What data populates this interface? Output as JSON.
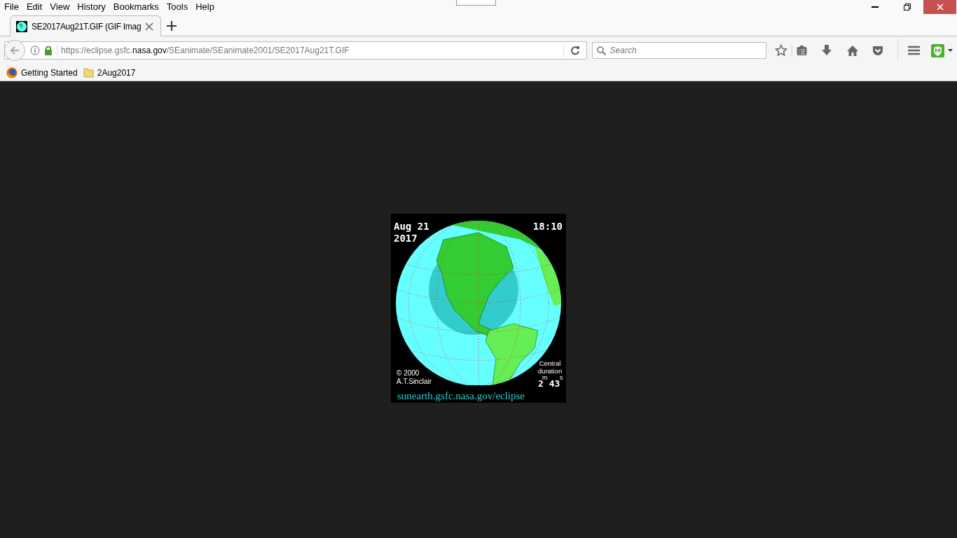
{
  "menu": [
    "File",
    "Edit",
    "View",
    "History",
    "Bookmarks",
    "Tools",
    "Help"
  ],
  "tab": {
    "title": "SE2017Aug21T.GIF (GIF Imag",
    "selected": true
  },
  "address": {
    "prefix": "https://eclipse.gsfc.",
    "domain": "nasa.gov",
    "path": "/SEanimate/SEanimate2001/SE2017Aug21T.GIF"
  },
  "search": {
    "placeholder": "Search"
  },
  "bookmarks": [
    {
      "kind": "firefox",
      "label": "Getting Started"
    },
    {
      "kind": "folder",
      "label": "2Aug2017"
    }
  ],
  "image": {
    "date": "Aug 21",
    "year": "2017",
    "time": "18:10",
    "copyright": "© 2000",
    "author": "A.T.Sinclair",
    "duration_label": "Central duration",
    "unit_minutes": "m",
    "unit_seconds": "s",
    "duration": "2 43",
    "site": "sunearth.gsfc.nasa.gov/eclipse"
  }
}
